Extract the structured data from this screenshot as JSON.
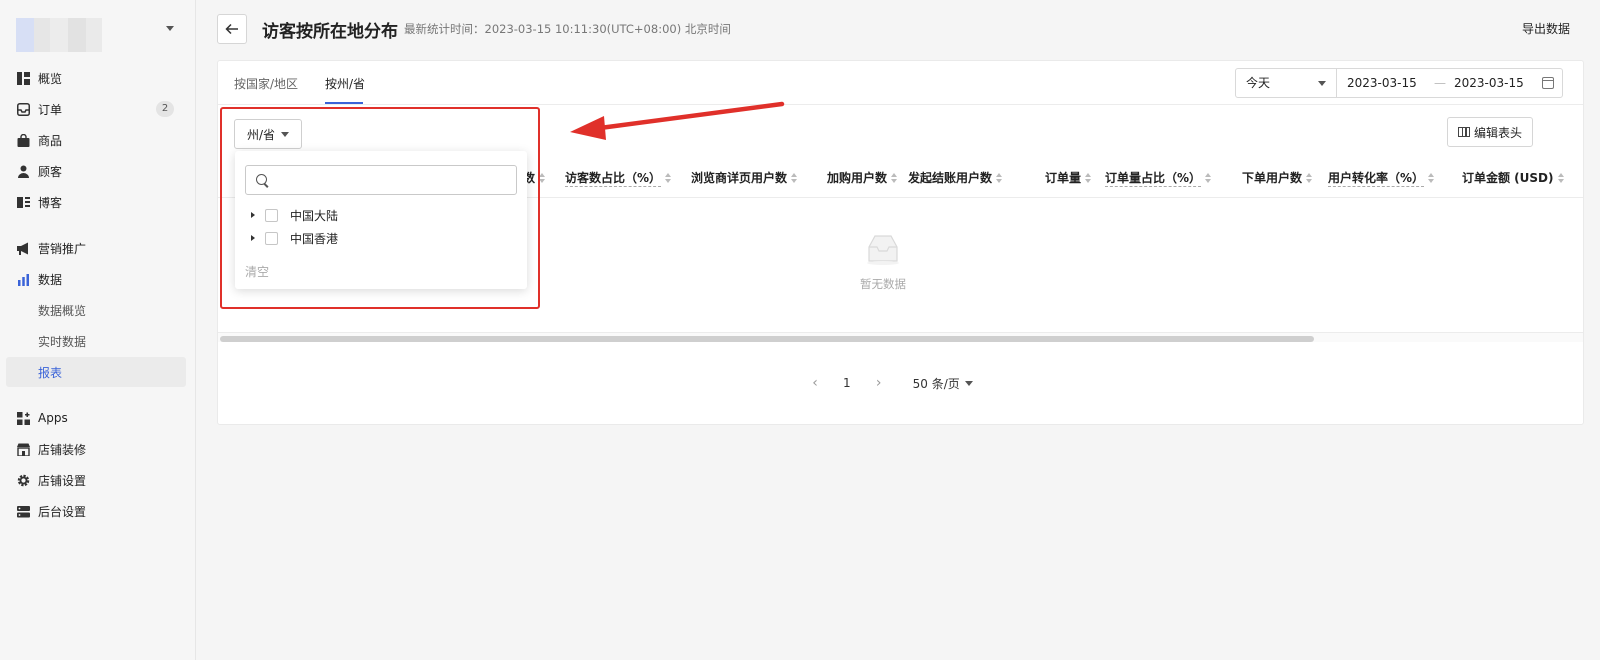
{
  "sidebar": {
    "items": [
      {
        "label": "概览",
        "icon": "dashboard-icon"
      },
      {
        "label": "订单",
        "icon": "inbox-icon",
        "badge": "2"
      },
      {
        "label": "商品",
        "icon": "shopping-bag-icon"
      },
      {
        "label": "顾客",
        "icon": "person-icon"
      },
      {
        "label": "博客",
        "icon": "blog-icon"
      },
      {
        "label": "营销推广",
        "icon": "megaphone-icon"
      },
      {
        "label": "数据",
        "icon": "bar-chart-icon"
      },
      {
        "label": "数据概览"
      },
      {
        "label": "实时数据"
      },
      {
        "label": "报表",
        "active": true
      },
      {
        "label": "Apps",
        "icon": "apps-icon"
      },
      {
        "label": "店铺装修",
        "icon": "store-icon"
      },
      {
        "label": "店铺设置",
        "icon": "gear-icon"
      },
      {
        "label": "后台设置",
        "icon": "server-icon"
      }
    ]
  },
  "header": {
    "title": "访客按所在地分布",
    "stat_time": "最新统计时间：2023-03-15 10:11:30(UTC+08:00) 北京时间",
    "export_label": "导出数据"
  },
  "tabs": [
    {
      "label": "按国家/地区",
      "active": false
    },
    {
      "label": "按州/省",
      "active": true
    }
  ],
  "date_filter": {
    "period": "今天",
    "from": "2023-03-15",
    "separator": "—",
    "to": "2023-03-15"
  },
  "edit_columns_label": "编辑表头",
  "table": {
    "columns": [
      {
        "label": "客数",
        "sortable": true,
        "dotted": false
      },
      {
        "label": "访客数占比（%）",
        "sortable": true,
        "dotted": true
      },
      {
        "label": "浏览商详页用户数",
        "sortable": true,
        "dotted": false
      },
      {
        "label": "加购用户数",
        "sortable": true,
        "dotted": false
      },
      {
        "label": "发起结账用户数",
        "sortable": true,
        "dotted": false
      },
      {
        "label": "订单量",
        "sortable": true,
        "dotted": false
      },
      {
        "label": "订单量占比（%）",
        "sortable": true,
        "dotted": true
      },
      {
        "label": "下单用户数",
        "sortable": true,
        "dotted": false
      },
      {
        "label": "用户转化率（%）",
        "sortable": true,
        "dotted": true
      },
      {
        "label": "订单金额 (USD)",
        "sortable": true,
        "dotted": false
      }
    ],
    "empty_text": "暂无数据"
  },
  "pagination": {
    "prev": "‹",
    "page": "1",
    "next": "›",
    "page_size": "50 条/页"
  },
  "region_filter": {
    "button_label": "州/省",
    "search_placeholder": "",
    "options": [
      {
        "label": "中国大陆",
        "checked": false
      },
      {
        "label": "中国香港",
        "checked": false
      }
    ],
    "clear_label": "清空"
  },
  "colors": {
    "accent": "#3a63d8",
    "annotation": "#e0302a"
  }
}
